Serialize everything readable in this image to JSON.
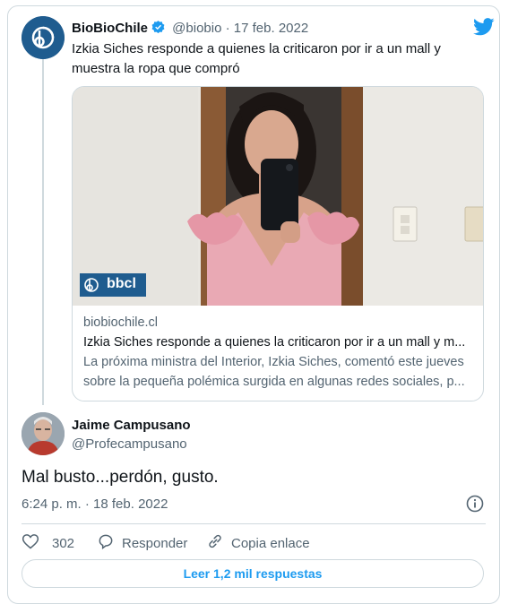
{
  "tweet": {
    "author_name": "BioBioChile",
    "author_handle": "@biobio",
    "date": "17 feb. 2022",
    "text": "Izkia Siches responde a quienes la criticaron por ir a un mall y muestra la ropa que compró",
    "link_card": {
      "image_watermark": "bbcl",
      "domain": "biobiochile.cl",
      "title": "Izkia Siches responde a quienes la criticaron por ir a un mall y m...",
      "description": "La próxima ministra del Interior, Izkia Siches, comentó este jueves sobre la pequeña polémica surgida en algunas redes sociales, p..."
    }
  },
  "reply": {
    "author_name": "Jaime Campusano",
    "author_handle": "@Profecampusano",
    "text": "Mal busto...perdón, gusto.",
    "timestamp": "6:24 p. m. · 18 feb. 2022"
  },
  "actions": {
    "likes": "302",
    "reply_label": "Responder",
    "copy_label": "Copia enlace"
  },
  "replies_button": "Leer 1,2 mil respuestas",
  "colors": {
    "accent": "#1d9bf0",
    "secondary_text": "#536471",
    "border": "#cfd9de",
    "brand": "#1f5c8f"
  },
  "icons": [
    "verified-badge-icon",
    "twitter-bird-icon",
    "info-icon",
    "heart-icon",
    "reply-bubble-icon",
    "link-icon"
  ]
}
